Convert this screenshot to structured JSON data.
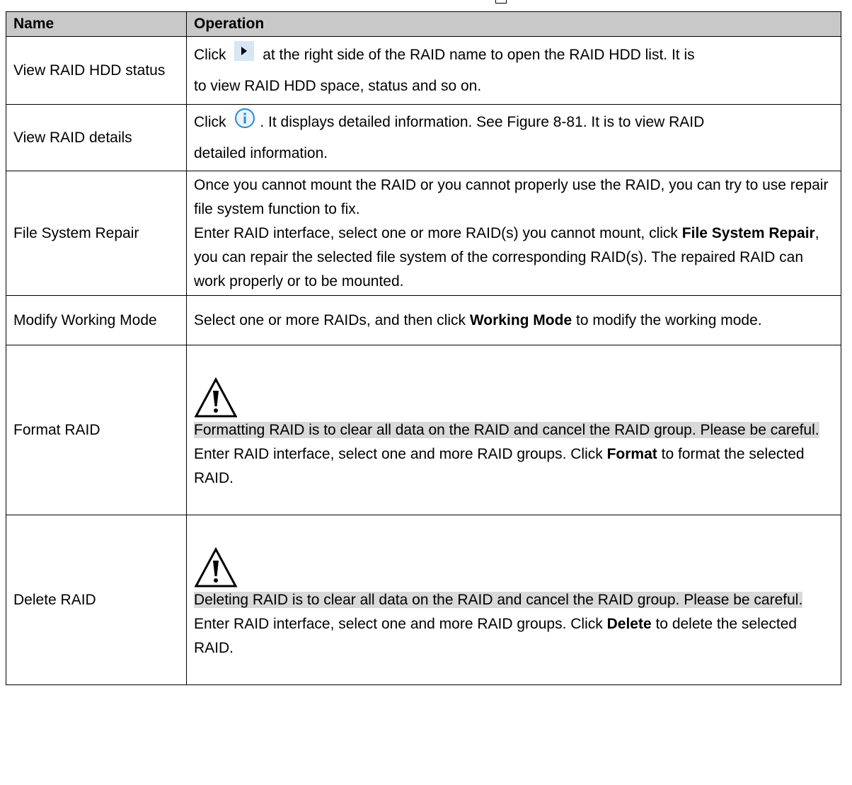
{
  "table": {
    "header": {
      "name": "Name",
      "operation": "Operation"
    },
    "rows": [
      {
        "name": "View RAID HDD status",
        "op_line1_pre": "Click",
        "op_line1_post": "at the right side of the RAID name to open the RAID HDD list. It is",
        "op_line2": "to view RAID HDD space, status and so on.",
        "icon": "play-arrow-icon"
      },
      {
        "name": "View RAID details",
        "op_line1_pre": "Click",
        "op_line1_post": ". It displays detailed information. See Figure 8-81. It is to view RAID",
        "op_line2": "detailed information.",
        "icon": "info-icon"
      },
      {
        "name": "File System Repair",
        "op_p1": "Once you cannot mount the RAID or you cannot properly use the RAID, you can try to use repair file system function to fix.",
        "op_p2_pre": "Enter RAID interface, select one or more RAID(s) you cannot mount, click",
        "op_p2_bold": "File System Repair",
        "op_p2_post": ", you can repair the selected file system of the corresponding RAID(s). The repaired RAID can work properly or to be mounted."
      },
      {
        "name": "Modify Working Mode",
        "op_pre": "Select one or more RAIDs, and then click",
        "op_bold": "Working Mode",
        "op_post": "to modify the working mode."
      },
      {
        "name": "Format RAID",
        "icon": "warning-icon",
        "warning": "Formatting RAID is to clear all data on the RAID and cancel the RAID group. Please be careful.",
        "op_pre": "Enter RAID interface, select one and more RAID groups. Click",
        "op_bold": "Format",
        "op_post": "to format the selected RAID."
      },
      {
        "name": "Delete RAID",
        "icon": "warning-icon",
        "warning": "Deleting RAID is to clear all data on the RAID and cancel the RAID group. Please be careful.",
        "op_pre": "Enter RAID interface, select one and more RAID groups. Click",
        "op_bold": "Delete",
        "op_post": "to delete the selected RAID."
      }
    ]
  },
  "colors": {
    "header_bg": "#c8c8c8",
    "warning_highlight": "#d9d9d9",
    "icon_bg": "#d6e6f5",
    "info_blue": "#2a8ad4"
  }
}
